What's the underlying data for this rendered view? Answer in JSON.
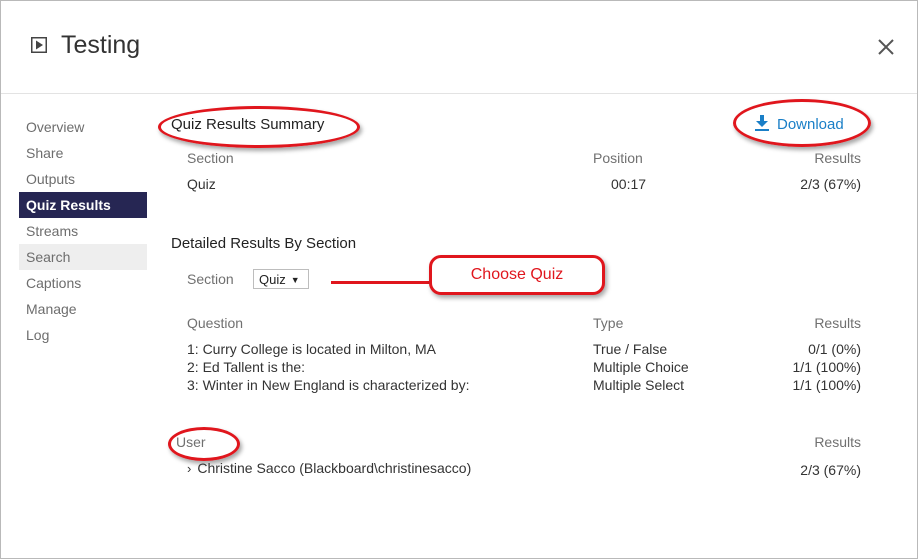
{
  "window": {
    "title": "Testing",
    "icons": {
      "play": "play-icon",
      "close": "close-icon"
    }
  },
  "sidebar": {
    "items": [
      {
        "label": "Overview"
      },
      {
        "label": "Share"
      },
      {
        "label": "Outputs"
      },
      {
        "label": "Quiz Results"
      },
      {
        "label": "Streams"
      },
      {
        "label": "Search"
      },
      {
        "label": "Captions"
      },
      {
        "label": "Manage"
      },
      {
        "label": "Log"
      }
    ],
    "active": "Quiz Results"
  },
  "summary": {
    "heading": "Quiz Results Summary",
    "download_label": "Download",
    "headers": {
      "section": "Section",
      "position": "Position",
      "results": "Results"
    },
    "row": {
      "section": "Quiz",
      "position": "00:17",
      "results": "2/3 (67%)"
    }
  },
  "detail": {
    "heading": "Detailed Results By Section",
    "section_label": "Section",
    "section_value": "Quiz",
    "callout": "Choose Quiz",
    "headers": {
      "question": "Question",
      "type": "Type",
      "results": "Results"
    },
    "rows": [
      {
        "question": "1: Curry College is located in Milton, MA",
        "type": "True / False",
        "results": "0/1 (0%)"
      },
      {
        "question": "2: Ed Tallent is the:",
        "type": "Multiple Choice",
        "results": "1/1 (100%)"
      },
      {
        "question": "3: Winter in New England is characterized by:",
        "type": "Multiple Select",
        "results": "1/1 (100%)"
      }
    ]
  },
  "users": {
    "headers": {
      "user": "User",
      "results": "Results"
    },
    "rows": [
      {
        "name": "Christine Sacco (Blackboard\\christinesacco)",
        "results": "2/3 (67%)"
      }
    ]
  },
  "colors": {
    "active_nav_bg": "#262653",
    "link": "#1a7fc7",
    "annotation": "#e0161d"
  }
}
